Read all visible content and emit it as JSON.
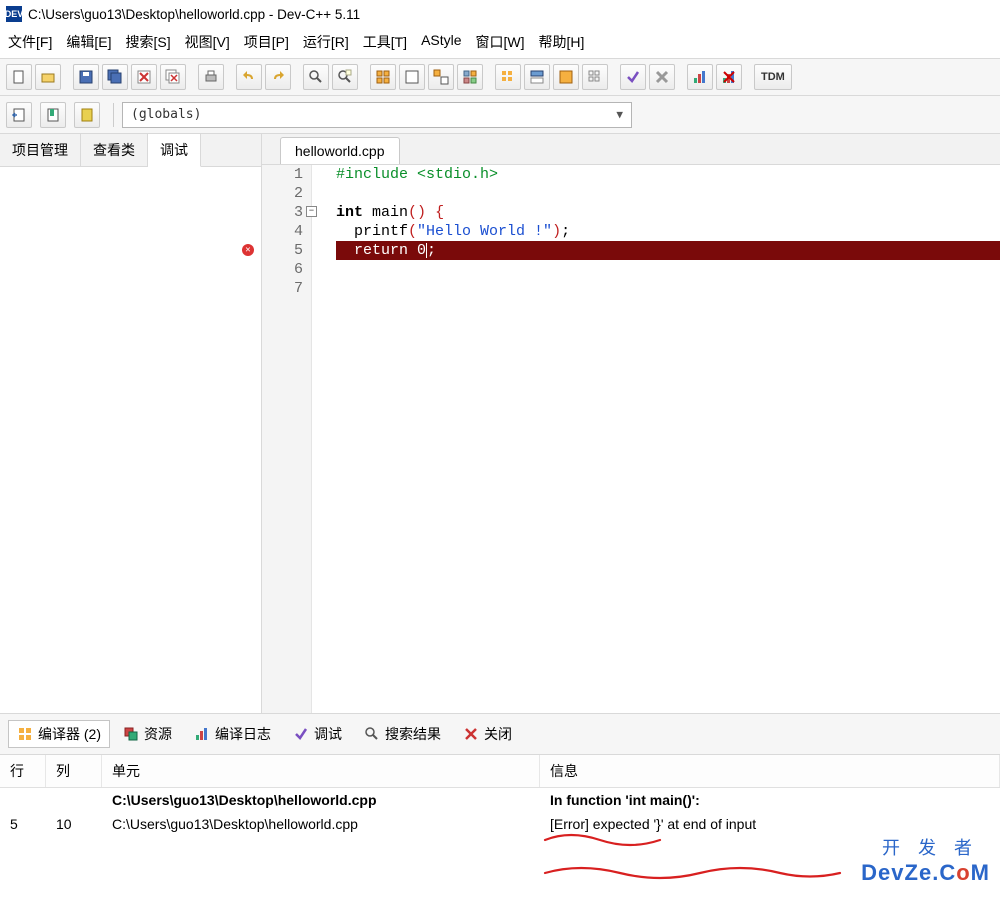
{
  "window": {
    "title": "C:\\Users\\guo13\\Desktop\\helloworld.cpp - Dev-C++ 5.11",
    "appicon_text": "DEV"
  },
  "menubar": [
    "文件[F]",
    "编辑[E]",
    "搜索[S]",
    "视图[V]",
    "项目[P]",
    "运行[R]",
    "工具[T]",
    "AStyle",
    "窗口[W]",
    "帮助[H]"
  ],
  "toolbar_groups": {
    "tdm_label": "TDM"
  },
  "globals_selector": "(globals)",
  "side_tabs": [
    "项目管理",
    "查看类",
    "调试"
  ],
  "side_tab_active": 2,
  "file_tab": "helloworld.cpp",
  "code": {
    "lines": [
      {
        "n": "1",
        "html": "<span class='pp'>#include &lt;stdio.h&gt;</span>"
      },
      {
        "n": "2",
        "html": ""
      },
      {
        "n": "3",
        "html": "<span class='kw'>int</span> main<span class='paren'>()</span> <span class='paren'>{</span>",
        "fold": true
      },
      {
        "n": "4",
        "html": "  printf<span class='paren'>(</span><span class='str'>\"Hello World !\"</span><span class='paren'>)</span>;"
      },
      {
        "n": "5",
        "html": "  return 0<span class='cursor'></span>;",
        "error": true
      },
      {
        "n": "6",
        "html": ""
      },
      {
        "n": "7",
        "html": ""
      }
    ]
  },
  "bottom_tabs": [
    {
      "label": "编译器 (2)",
      "icon": "grid"
    },
    {
      "label": "资源",
      "icon": "copies"
    },
    {
      "label": "编译日志",
      "icon": "chart"
    },
    {
      "label": "调试",
      "icon": "check"
    },
    {
      "label": "搜索结果",
      "icon": "search"
    },
    {
      "label": "关闭",
      "icon": "close"
    }
  ],
  "bottom_tab_active": 0,
  "error_table": {
    "headers": {
      "line": "行",
      "col": "列",
      "unit": "单元",
      "msg": "信息"
    },
    "rows": [
      {
        "line": "",
        "col": "",
        "unit": "C:\\Users\\guo13\\Desktop\\helloworld.cpp",
        "msg": "In function 'int main()':",
        "bold": true
      },
      {
        "line": "5",
        "col": "10",
        "unit": "C:\\Users\\guo13\\Desktop\\helloworld.cpp",
        "msg": "[Error] expected '}' at end of input",
        "bold": false
      }
    ]
  },
  "watermark": {
    "zh": "开发者",
    "en_pre": "DevZe.C",
    "en_o": "o",
    "en_post": "M"
  }
}
